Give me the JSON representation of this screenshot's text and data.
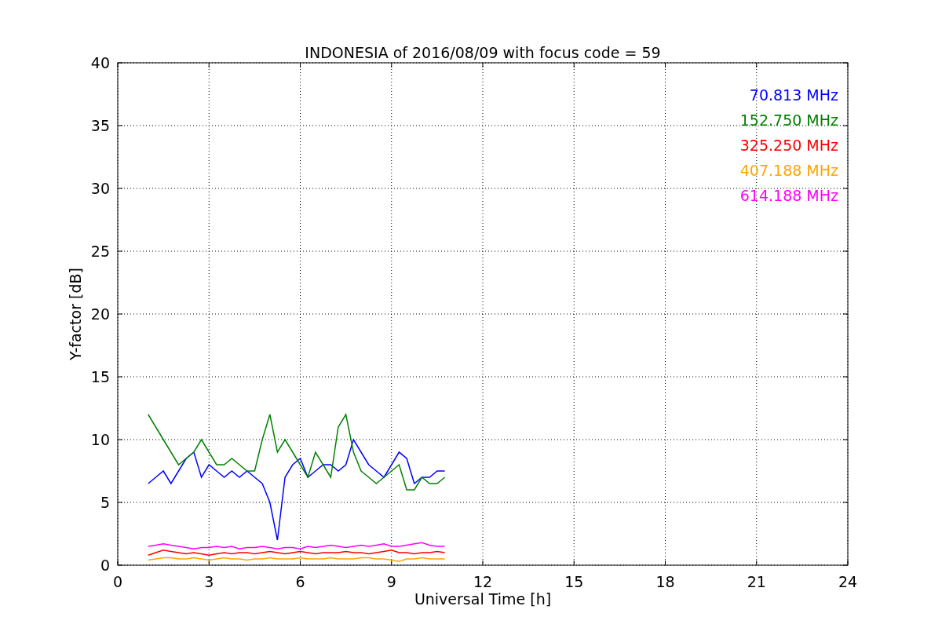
{
  "chart_data": {
    "type": "line",
    "title": "INDONESIA of 2016/08/09 with focus code = 59",
    "xlabel": "Universal Time [h]",
    "ylabel": "Y-factor [dB]",
    "x": [
      1,
      1.25,
      1.5,
      1.75,
      2,
      2.25,
      2.5,
      2.75,
      3,
      3.25,
      3.5,
      3.75,
      4,
      4.25,
      4.5,
      4.75,
      5,
      5.25,
      5.5,
      5.75,
      6,
      6.25,
      6.5,
      6.75,
      7,
      7.25,
      7.5,
      7.75,
      8,
      8.25,
      8.5,
      8.75,
      9,
      9.25,
      9.5,
      9.75,
      10,
      10.25,
      10.5,
      10.75
    ],
    "series": [
      {
        "name": "70.813 MHz",
        "color": "#0000ff",
        "values": [
          6.5,
          7,
          7.5,
          6.5,
          7.5,
          8.5,
          9,
          7,
          8,
          7.5,
          7,
          7.5,
          7,
          7.5,
          7,
          6.5,
          5,
          2,
          7,
          8,
          8.5,
          7,
          7.5,
          8,
          8,
          7.5,
          8,
          10,
          9,
          8,
          7.5,
          7,
          8,
          9,
          8.5,
          6.5,
          7,
          7,
          7.5,
          7.5
        ]
      },
      {
        "name": "152.750 MHz",
        "color": "#008000",
        "values": [
          12,
          11,
          10,
          9,
          8,
          8.5,
          9,
          10,
          9,
          8,
          8,
          8.5,
          8,
          7.5,
          7.5,
          10,
          12,
          9,
          10,
          9,
          8,
          7,
          9,
          8,
          7,
          11,
          12,
          9,
          7.5,
          7,
          6.5,
          7,
          7.5,
          8,
          6,
          6,
          7,
          6.5,
          6.5,
          7
        ]
      },
      {
        "name": "325.250 MHz",
        "color": "#ff0000",
        "values": [
          0.8,
          1,
          1.2,
          1.1,
          1,
          0.9,
          1,
          0.9,
          0.8,
          0.9,
          1,
          0.9,
          1,
          1,
          0.9,
          1,
          1.1,
          1,
          0.9,
          1,
          1.1,
          1,
          0.9,
          1,
          1,
          1,
          1.1,
          1,
          1,
          0.9,
          1,
          1.1,
          1.2,
          1,
          1,
          0.9,
          1,
          1,
          1.1,
          1
        ]
      },
      {
        "name": "407.188 MHz",
        "color": "#ffa500",
        "values": [
          0.4,
          0.5,
          0.6,
          0.6,
          0.5,
          0.5,
          0.6,
          0.5,
          0.4,
          0.5,
          0.6,
          0.5,
          0.5,
          0.4,
          0.5,
          0.5,
          0.6,
          0.5,
          0.5,
          0.5,
          0.6,
          0.5,
          0.5,
          0.5,
          0.6,
          0.5,
          0.5,
          0.5,
          0.6,
          0.6,
          0.5,
          0.5,
          0.4,
          0.3,
          0.5,
          0.5,
          0.6,
          0.5,
          0.5,
          0.5
        ]
      },
      {
        "name": "614.188 MHz",
        "color": "#ff00ff",
        "values": [
          1.5,
          1.6,
          1.7,
          1.6,
          1.5,
          1.4,
          1.3,
          1.4,
          1.4,
          1.5,
          1.4,
          1.5,
          1.3,
          1.4,
          1.4,
          1.5,
          1.4,
          1.3,
          1.4,
          1.4,
          1.3,
          1.5,
          1.4,
          1.5,
          1.6,
          1.5,
          1.4,
          1.5,
          1.6,
          1.5,
          1.6,
          1.7,
          1.5,
          1.5,
          1.6,
          1.7,
          1.8,
          1.6,
          1.5,
          1.5
        ]
      }
    ],
    "grid": true,
    "xlim": [
      0,
      24
    ],
    "ylim": [
      0,
      40
    ],
    "xticks": [
      0,
      3,
      6,
      9,
      12,
      15,
      18,
      21,
      24
    ],
    "yticks": [
      0,
      5,
      10,
      15,
      20,
      25,
      30,
      35,
      40
    ]
  }
}
